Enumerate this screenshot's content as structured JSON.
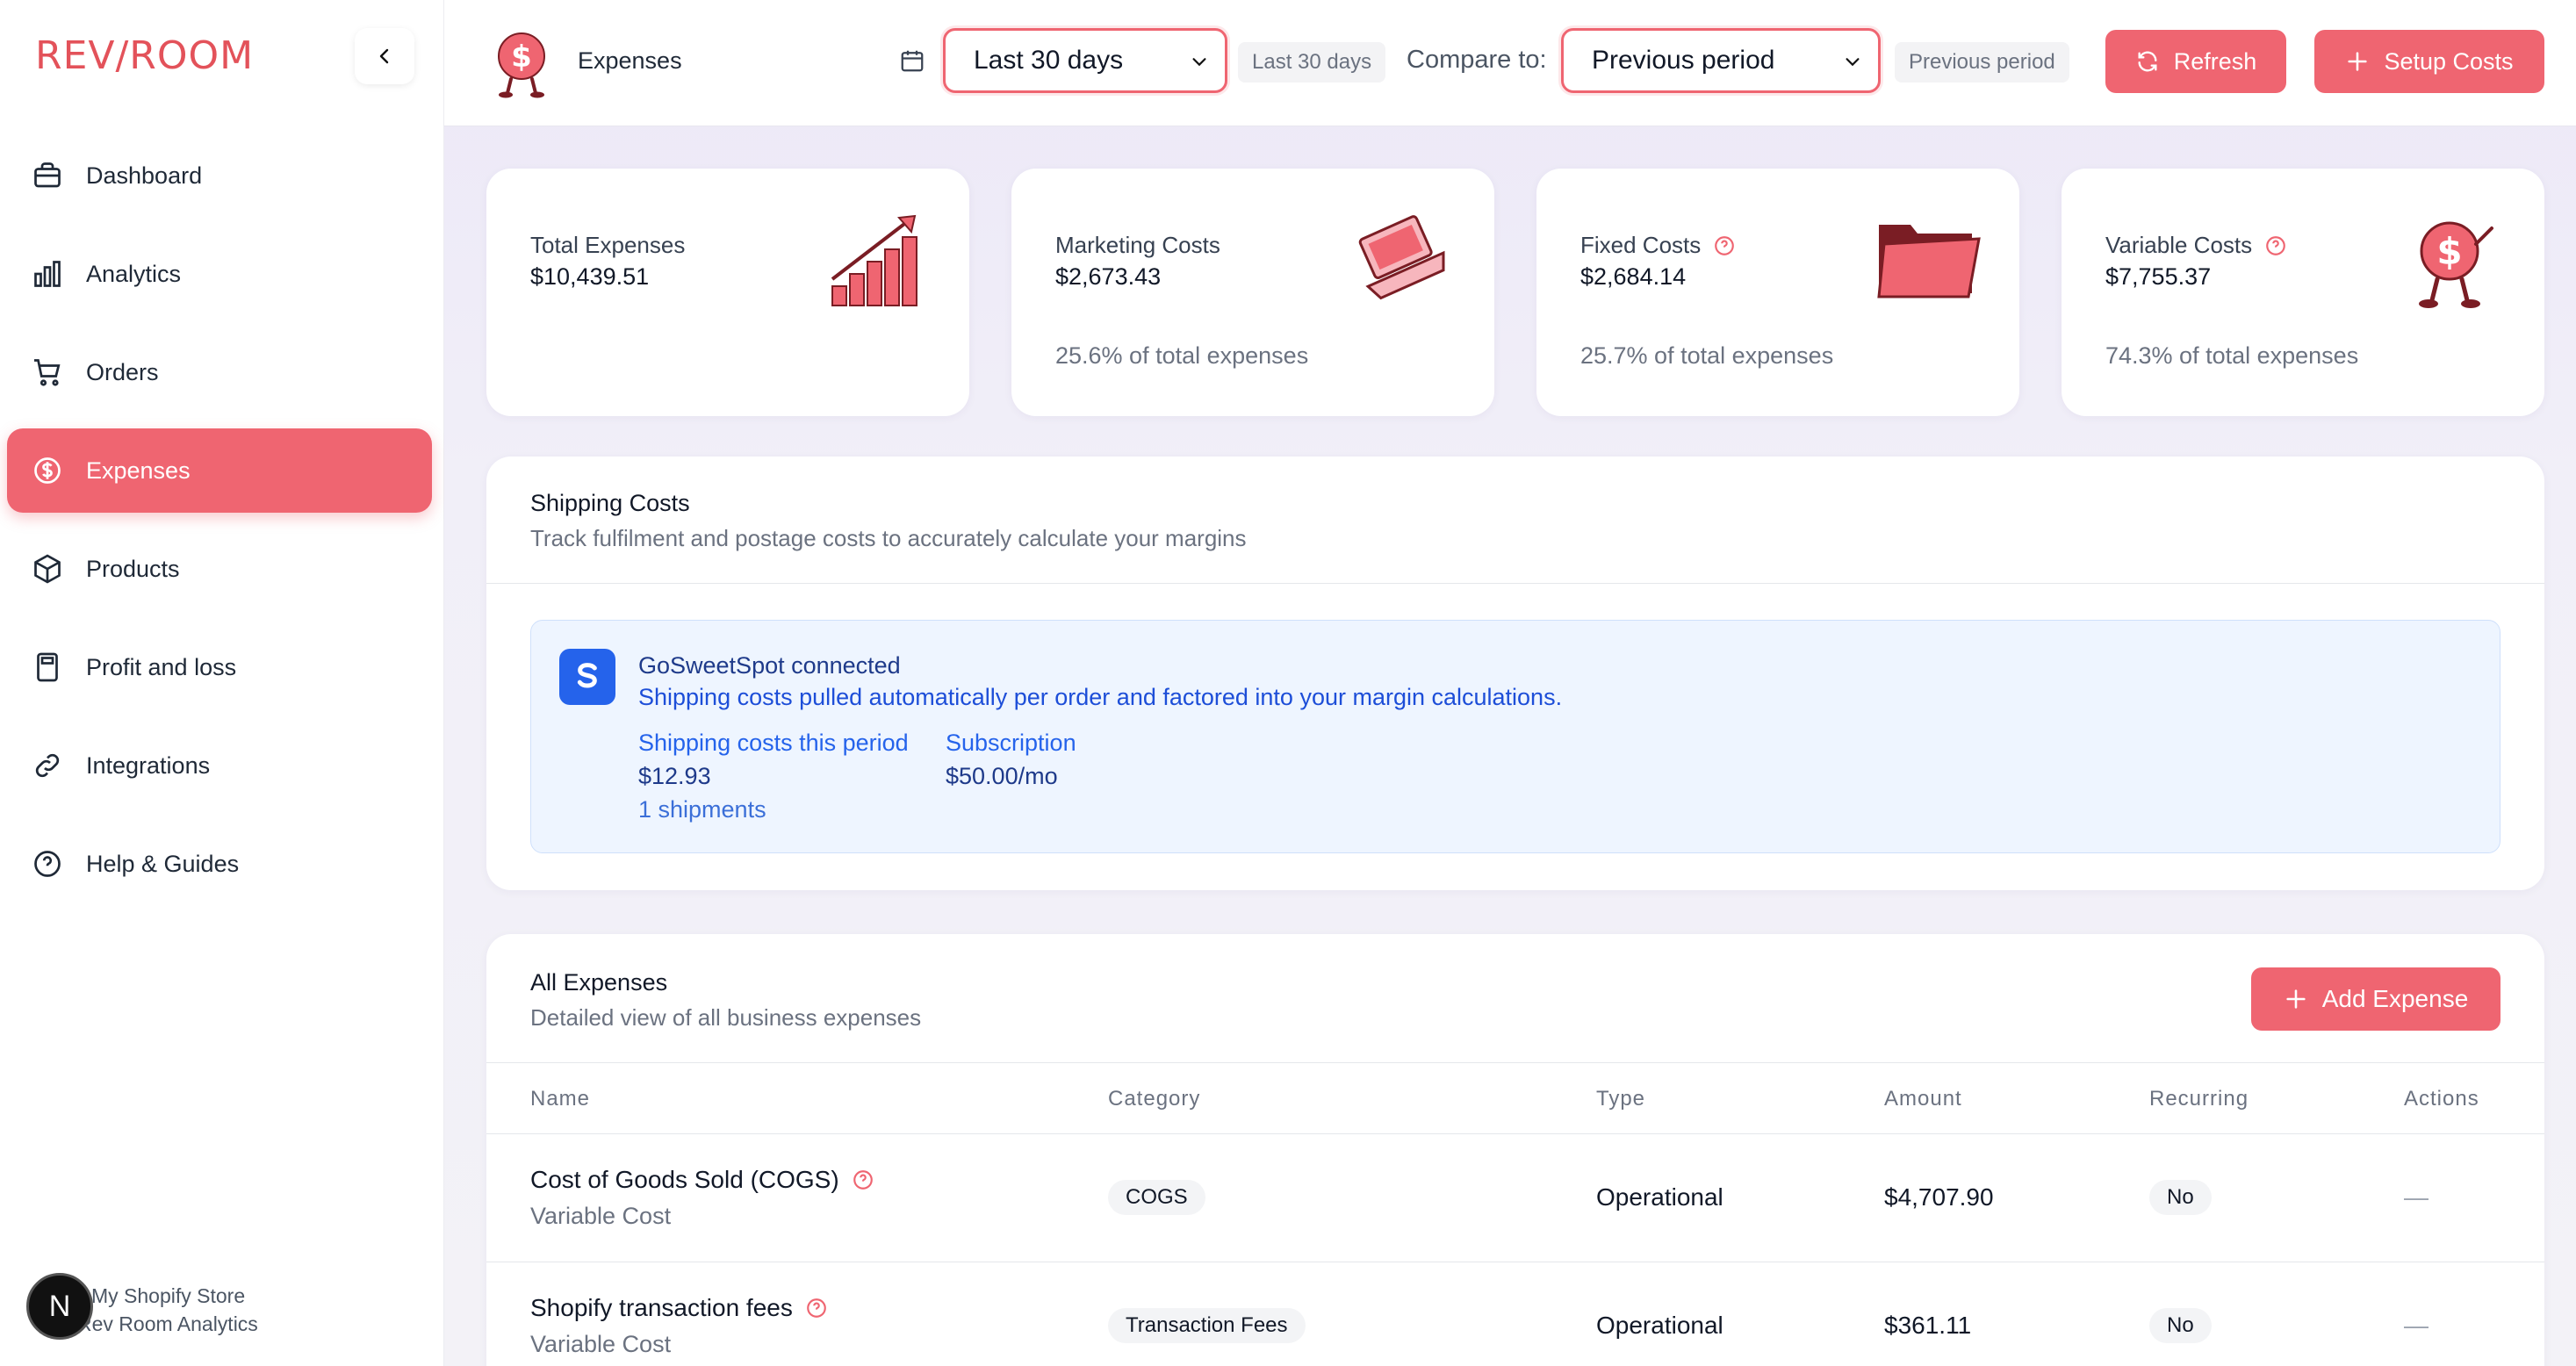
{
  "app": {
    "logo_text": "REV/ROOM"
  },
  "sidebar": {
    "items": [
      {
        "label": "Dashboard",
        "icon": "briefcase-icon",
        "active": false
      },
      {
        "label": "Analytics",
        "icon": "bar-chart-icon",
        "active": false
      },
      {
        "label": "Orders",
        "icon": "cart-icon",
        "active": false
      },
      {
        "label": "Expenses",
        "icon": "dollar-circle-icon",
        "active": true
      },
      {
        "label": "Products",
        "icon": "box-icon",
        "active": false
      },
      {
        "label": "Profit and loss",
        "icon": "calculator-icon",
        "active": false
      },
      {
        "label": "Integrations",
        "icon": "link-icon",
        "active": false
      },
      {
        "label": "Help & Guides",
        "icon": "help-circle-icon",
        "active": false
      }
    ],
    "store": {
      "avatar_letter": "N",
      "line1": "My Shopify Store",
      "line2": "Rev Room Analytics"
    }
  },
  "topbar": {
    "title": "Expenses",
    "date_range": {
      "selected": "Last 30 days",
      "chip": "Last 30 days"
    },
    "compare": {
      "label": "Compare to:",
      "selected": "Previous period",
      "chip": "Previous period"
    },
    "refresh_label": "Refresh",
    "setup_label": "Setup Costs"
  },
  "stats": [
    {
      "label": "Total Expenses",
      "value": "$10,439.51",
      "sub": "",
      "help": false,
      "art": "growth-bars-icon"
    },
    {
      "label": "Marketing Costs",
      "value": "$2,673.43",
      "sub": "25.6% of total expenses",
      "help": false,
      "art": "laptop-icon"
    },
    {
      "label": "Fixed Costs",
      "value": "$2,684.14",
      "sub": "25.7% of total expenses",
      "help": true,
      "art": "folder-icon"
    },
    {
      "label": "Variable Costs",
      "value": "$7,755.37",
      "sub": "74.3% of total expenses",
      "help": true,
      "art": "dollar-mascot-icon"
    }
  ],
  "shipping": {
    "title": "Shipping Costs",
    "subtitle": "Track fulfilment and postage costs to accurately calculate your margins",
    "provider": {
      "title": "GoSweetSpot connected",
      "description": "Shipping costs pulled automatically per order and factored into your margin calculations.",
      "period_label": "Shipping costs this period",
      "period_value": "$12.93",
      "period_extra": "1 shipments",
      "subscription_label": "Subscription",
      "subscription_value": "$50.00/mo"
    }
  },
  "expenses": {
    "title": "All Expenses",
    "subtitle": "Detailed view of all business expenses",
    "add_label": "Add Expense",
    "columns": [
      "Name",
      "Category",
      "Type",
      "Amount",
      "Recurring",
      "Actions"
    ],
    "rows": [
      {
        "name": "Cost of Goods Sold (COGS)",
        "sub": "Variable Cost",
        "category": "COGS",
        "type": "Operational",
        "amount": "$4,707.90",
        "recurring": "No",
        "actions": "—"
      },
      {
        "name": "Shopify transaction fees",
        "sub": "Variable Cost",
        "category": "Transaction Fees",
        "type": "Operational",
        "amount": "$361.11",
        "recurring": "No",
        "actions": "—"
      }
    ]
  },
  "colors": {
    "accent": "#ef6571",
    "brand": "#e3525a",
    "info_bg": "#eef5ff",
    "info_text": "#1d4ed8"
  }
}
